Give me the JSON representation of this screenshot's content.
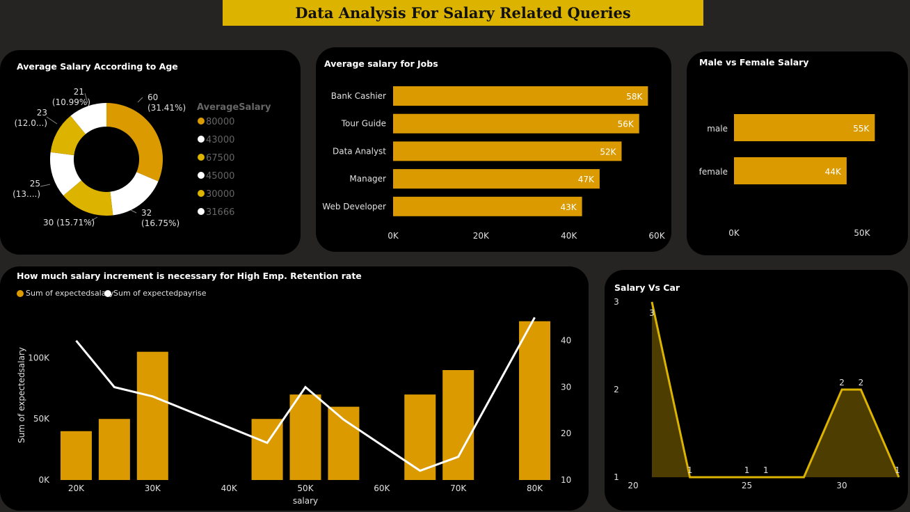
{
  "page_title": "Data Analysis For Salary Related Queries",
  "colors": {
    "gold": "#dcb400",
    "bar": "#db9b00",
    "white": "#ffffff",
    "label": "#e0e0e0"
  },
  "chart_data": [
    {
      "type": "pie",
      "title": "Average Salary According to Age",
      "legend_title": "AverageSalary",
      "legend_position": "right",
      "slices": [
        {
          "label": "60",
          "pct_text": "(31.41%)",
          "percent": 31.41,
          "color": "#db9b00",
          "legend": "80000"
        },
        {
          "label": "32",
          "pct_text": "(16.75%)",
          "percent": 16.75,
          "color": "#ffffff",
          "legend": "43000"
        },
        {
          "label": "30",
          "pct_text": "(15.71%)",
          "percent": 15.71,
          "color": "#dcb400",
          "legend": "67500"
        },
        {
          "label": "25",
          "pct_text": "(13....)",
          "percent": 13.14,
          "color": "#ffffff",
          "legend": "45000"
        },
        {
          "label": "23",
          "pct_text": "(12.0...)",
          "percent": 12.0,
          "color": "#dcb400",
          "legend": "30000"
        },
        {
          "label": "21",
          "pct_text": "(10.99%)",
          "percent": 10.99,
          "color": "#ffffff",
          "legend": "31666"
        }
      ]
    },
    {
      "type": "bar",
      "orientation": "horizontal",
      "title": "Average salary for Jobs",
      "categories": [
        "Bank Cashier",
        "Tour Guide",
        "Data Analyst",
        "Manager",
        "Web Developer"
      ],
      "values": [
        58000,
        56000,
        52000,
        47000,
        43000
      ],
      "value_labels": [
        "58K",
        "56K",
        "52K",
        "47K",
        "43K"
      ],
      "xlim": [
        0,
        60000
      ],
      "xticks": [
        "0K",
        "20K",
        "40K",
        "60K"
      ]
    },
    {
      "type": "bar",
      "orientation": "horizontal",
      "title": "Male vs Female Salary",
      "categories": [
        "male",
        "female"
      ],
      "values": [
        55000,
        44000
      ],
      "value_labels": [
        "55K",
        "44K"
      ],
      "xlim": [
        0,
        60000
      ],
      "xticks": [
        {
          "label": "0K",
          "value": 0
        },
        {
          "label": "50K",
          "value": 50000
        }
      ]
    },
    {
      "type": "bar",
      "title": "How much salary increment is necessary for High Emp. Retention rate",
      "xlabel": "salary",
      "ylabel": "Sum of expectedsalary",
      "legend_position": "top-left",
      "x": [
        20000,
        25000,
        30000,
        45000,
        50000,
        55000,
        65000,
        70000,
        80000
      ],
      "series": [
        {
          "name": "Sum of expectedsalary",
          "type": "bar",
          "values": [
            40000,
            50000,
            105000,
            50000,
            70000,
            60000,
            70000,
            90000,
            130000
          ]
        },
        {
          "name": "Sum of expectedpayrise",
          "type": "line",
          "axis": "right",
          "values": [
            40,
            30,
            28,
            18,
            30,
            23,
            12,
            15,
            45
          ]
        }
      ],
      "xlim": [
        17500,
        82500
      ],
      "ylim": [
        0,
        135000
      ],
      "y2lim": [
        10,
        45.5
      ],
      "xticks": [
        {
          "label": "20K",
          "value": 20000
        },
        {
          "label": "30K",
          "value": 30000
        },
        {
          "label": "40K",
          "value": 40000
        },
        {
          "label": "50K",
          "value": 50000
        },
        {
          "label": "60K",
          "value": 60000
        },
        {
          "label": "70K",
          "value": 70000
        },
        {
          "label": "80K",
          "value": 80000
        }
      ],
      "yticks": [
        {
          "label": "0K",
          "value": 0
        },
        {
          "label": "50K",
          "value": 50000
        },
        {
          "label": "100K",
          "value": 100000
        }
      ],
      "y2ticks": [
        {
          "label": "10",
          "value": 10
        },
        {
          "label": "20",
          "value": 20
        },
        {
          "label": "30",
          "value": 30
        },
        {
          "label": "40",
          "value": 40
        }
      ]
    },
    {
      "type": "area",
      "title": "Salary Vs Car",
      "x": [
        20,
        22,
        24,
        25,
        26,
        28,
        29,
        30,
        31,
        32,
        33
      ],
      "values": [
        3,
        1,
        1,
        1,
        1,
        1,
        1.5,
        2,
        2,
        1.5,
        1
      ],
      "labels": [
        {
          "x": 20,
          "y": 3,
          "text": "3"
        },
        {
          "x": 22,
          "y": 1,
          "text": "1"
        },
        {
          "x": 25,
          "y": 1,
          "text": "1"
        },
        {
          "x": 26,
          "y": 1,
          "text": "1"
        },
        {
          "x": 30,
          "y": 2,
          "text": "2"
        },
        {
          "x": 31,
          "y": 2,
          "text": "2"
        },
        {
          "x": 33,
          "y": 1,
          "text": "1"
        }
      ],
      "xlim": [
        20,
        33
      ],
      "ylim": [
        1,
        3
      ],
      "xticks": [
        "20",
        "25",
        "30"
      ],
      "yticks": [
        "1",
        "2",
        "3"
      ]
    }
  ]
}
